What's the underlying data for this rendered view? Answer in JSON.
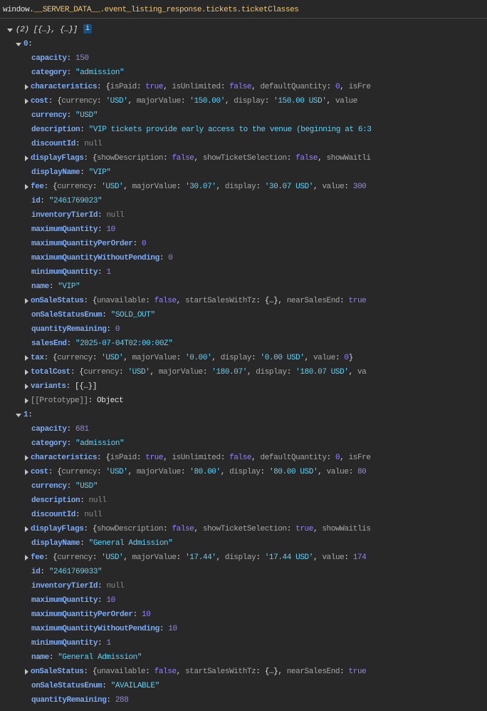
{
  "header": {
    "prefix": "window.",
    "expression": "__SERVER_DATA__.event_listing_response.tickets.ticketClasses"
  },
  "colors": {
    "background": "#282828",
    "key": "#7cacf8",
    "string": "#5cd5fb",
    "number": "#9980ff",
    "null": "#8b8b8b",
    "preview_key": "#a8a8a8"
  },
  "rows": [
    {
      "lv": "array",
      "text": "(2) [{…}, {…}]",
      "badge": "i"
    },
    {
      "lv": "index",
      "k": "0"
    },
    {
      "k": "capacity",
      "t": "n",
      "v": "150"
    },
    {
      "k": "category",
      "t": "s",
      "v": "\"admission\""
    },
    {
      "k": "characteristics",
      "exp": true,
      "pv": [
        [
          "isPaid",
          "b",
          "true"
        ],
        [
          "isUnlimited",
          "b",
          "false"
        ],
        [
          "defaultQuantity",
          "n",
          "0"
        ],
        [
          "isFre"
        ]
      ]
    },
    {
      "k": "cost",
      "exp": true,
      "pv": [
        [
          "currency",
          "s",
          "'USD'"
        ],
        [
          "majorValue",
          "s",
          "'150.00'"
        ],
        [
          "display",
          "s",
          "'150.00 USD'"
        ],
        [
          "value"
        ]
      ]
    },
    {
      "k": "currency",
      "t": "s",
      "v": "\"USD\""
    },
    {
      "k": "description",
      "t": "s",
      "v": "\"VIP tickets provide early access to the venue (beginning at 6:3"
    },
    {
      "k": "discountId",
      "t": "nl",
      "v": "null"
    },
    {
      "k": "displayFlags",
      "exp": true,
      "pv": [
        [
          "showDescription",
          "b",
          "false"
        ],
        [
          "showTicketSelection",
          "b",
          "false"
        ],
        [
          "showWaitli"
        ]
      ]
    },
    {
      "k": "displayName",
      "t": "s",
      "v": "\"VIP\""
    },
    {
      "k": "fee",
      "exp": true,
      "pv": [
        [
          "currency",
          "s",
          "'USD'"
        ],
        [
          "majorValue",
          "s",
          "'30.07'"
        ],
        [
          "display",
          "s",
          "'30.07 USD'"
        ],
        [
          "value",
          "n",
          "300"
        ]
      ]
    },
    {
      "k": "id",
      "t": "s",
      "v": "\"2461769023\""
    },
    {
      "k": "inventoryTierId",
      "t": "nl",
      "v": "null"
    },
    {
      "k": "maximumQuantity",
      "t": "n",
      "v": "10"
    },
    {
      "k": "maximumQuantityPerOrder",
      "t": "n",
      "v": "0"
    },
    {
      "k": "maximumQuantityWithoutPending",
      "t": "n",
      "v": "0"
    },
    {
      "k": "minimumQuantity",
      "t": "n",
      "v": "1"
    },
    {
      "k": "name",
      "t": "s",
      "v": "\"VIP\""
    },
    {
      "k": "onSaleStatus",
      "exp": true,
      "pv": [
        [
          "unavailable",
          "b",
          "false"
        ],
        [
          "startSalesWithTz",
          "o",
          "{…}"
        ],
        [
          "nearSalesEnd",
          "b",
          "true"
        ]
      ]
    },
    {
      "k": "onSaleStatusEnum",
      "t": "s",
      "v": "\"SOLD_OUT\""
    },
    {
      "k": "quantityRemaining",
      "t": "n",
      "v": "0"
    },
    {
      "k": "salesEnd",
      "t": "s",
      "v": "\"2025-07-04T02:00:00Z\""
    },
    {
      "k": "tax",
      "exp": true,
      "closed": true,
      "pv": [
        [
          "currency",
          "s",
          "'USD'"
        ],
        [
          "majorValue",
          "s",
          "'0.00'"
        ],
        [
          "display",
          "s",
          "'0.00 USD'"
        ],
        [
          "value",
          "n",
          "0"
        ]
      ]
    },
    {
      "k": "totalCost",
      "exp": true,
      "pv": [
        [
          "currency",
          "s",
          "'USD'"
        ],
        [
          "majorValue",
          "s",
          "'180.07'"
        ],
        [
          "display",
          "s",
          "'180.07 USD'"
        ],
        [
          "va"
        ]
      ]
    },
    {
      "k": "variants",
      "exp": true,
      "t": "o",
      "v": "[{…}]"
    },
    {
      "k": "[[Prototype]]",
      "exp": true,
      "grey": true,
      "t": "o",
      "v": "Object"
    },
    {
      "lv": "index",
      "k": "1"
    },
    {
      "k": "capacity",
      "t": "n",
      "v": "681"
    },
    {
      "k": "category",
      "t": "s",
      "v": "\"admission\""
    },
    {
      "k": "characteristics",
      "exp": true,
      "pv": [
        [
          "isPaid",
          "b",
          "true"
        ],
        [
          "isUnlimited",
          "b",
          "false"
        ],
        [
          "defaultQuantity",
          "n",
          "0"
        ],
        [
          "isFre"
        ]
      ]
    },
    {
      "k": "cost",
      "exp": true,
      "pv": [
        [
          "currency",
          "s",
          "'USD'"
        ],
        [
          "majorValue",
          "s",
          "'80.00'"
        ],
        [
          "display",
          "s",
          "'80.00 USD'"
        ],
        [
          "value",
          "n",
          "80"
        ]
      ]
    },
    {
      "k": "currency",
      "t": "s",
      "v": "\"USD\""
    },
    {
      "k": "description",
      "t": "nl",
      "v": "null"
    },
    {
      "k": "discountId",
      "t": "nl",
      "v": "null"
    },
    {
      "k": "displayFlags",
      "exp": true,
      "pv": [
        [
          "showDescription",
          "b",
          "false"
        ],
        [
          "showTicketSelection",
          "b",
          "true"
        ],
        [
          "showWaitlis"
        ]
      ]
    },
    {
      "k": "displayName",
      "t": "s",
      "v": "\"General Admission\""
    },
    {
      "k": "fee",
      "exp": true,
      "pv": [
        [
          "currency",
          "s",
          "'USD'"
        ],
        [
          "majorValue",
          "s",
          "'17.44'"
        ],
        [
          "display",
          "s",
          "'17.44 USD'"
        ],
        [
          "value",
          "n",
          "174"
        ]
      ]
    },
    {
      "k": "id",
      "t": "s",
      "v": "\"2461769033\""
    },
    {
      "k": "inventoryTierId",
      "t": "nl",
      "v": "null"
    },
    {
      "k": "maximumQuantity",
      "t": "n",
      "v": "10"
    },
    {
      "k": "maximumQuantityPerOrder",
      "t": "n",
      "v": "10"
    },
    {
      "k": "maximumQuantityWithoutPending",
      "t": "n",
      "v": "10"
    },
    {
      "k": "minimumQuantity",
      "t": "n",
      "v": "1"
    },
    {
      "k": "name",
      "t": "s",
      "v": "\"General Admission\""
    },
    {
      "k": "onSaleStatus",
      "exp": true,
      "pv": [
        [
          "unavailable",
          "b",
          "false"
        ],
        [
          "startSalesWithTz",
          "o",
          "{…}"
        ],
        [
          "nearSalesEnd",
          "b",
          "true"
        ]
      ]
    },
    {
      "k": "onSaleStatusEnum",
      "t": "s",
      "v": "\"AVAILABLE\""
    },
    {
      "k": "quantityRemaining",
      "t": "n",
      "v": "288"
    }
  ]
}
